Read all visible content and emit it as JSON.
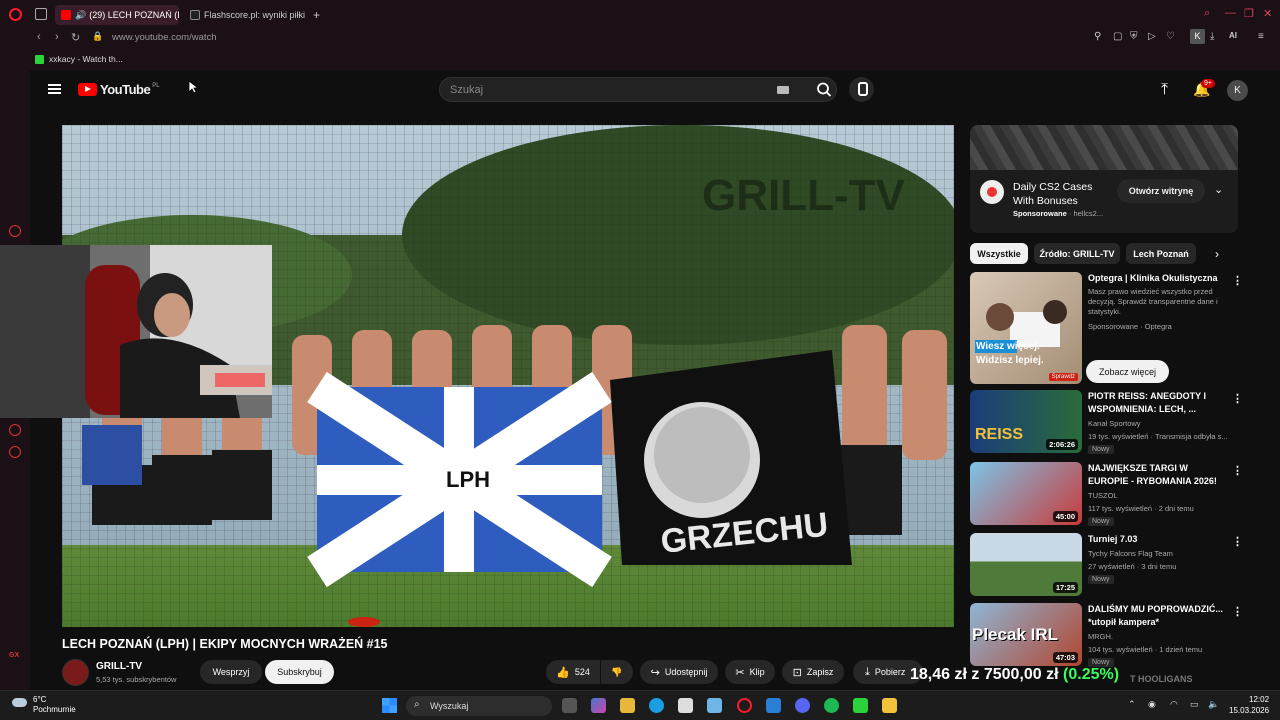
{
  "browser": {
    "tabs": [
      {
        "label": "(29) LECH POZNAŃ (L",
        "active": true
      },
      {
        "label": "Flashscore.pl: wyniki piłki",
        "active": false
      }
    ],
    "new_tab": "+",
    "url": "www.youtube.com/watch",
    "bookmark": "xxkacy - Watch th...",
    "profile_initial": "K",
    "ai_label": "AI",
    "sidebar_gx": "GX"
  },
  "youtube": {
    "logo_text": "YouTube",
    "region": "PL",
    "search_placeholder": "Szukaj",
    "notifications": "9+",
    "account_initial": "K",
    "video": {
      "title": "LECH POZNAŃ (LPH) | EKIPY MOCNYCH WRAŻEŃ #15",
      "overlay_watermark": "GRILL-TV",
      "banner_text": "LPH",
      "banner2_text": "GRZECHU"
    },
    "channel": {
      "name": "GRILL-TV",
      "subs": "5,53 tys. subskrybentów"
    },
    "actions": {
      "support": "Wesprzyj",
      "subscribe": "Subskrybuj",
      "likes": "524",
      "share": "Udostępnij",
      "clip": "Klip",
      "save": "Zapisz",
      "download": "Pobierz"
    },
    "ad": {
      "title": "Daily CS2 Cases With Bonuses",
      "sponsored": "Sponsorowane",
      "domain": "hellcs2...",
      "button": "Otwórz witrynę"
    },
    "chips": [
      "Wszystkie",
      "Źródło: GRILL-TV",
      "Lech Poznań"
    ],
    "recommendations": [
      {
        "title": "Optegra | Klinika Okulistyczna",
        "channel": "Masz prawo wiedzieć wszystko przed decyzją. Sprawdź transparentne dane i statystyki.",
        "meta": "Sponsorowane · Optegra",
        "thumb_text_1": "Wiesz więcej.",
        "thumb_text_2": "Widzisz lepiej.",
        "cta": "Zobacz więcej",
        "sponsored_tag": "Sprawdź"
      },
      {
        "title": "PIOTR REISS:  ANEGDOTY I WSPOMNIENIA: LECH, ...",
        "channel": "Kanał Sportowy",
        "meta": "19 tys. wyświetleń · Transmisja odbyła s...",
        "badge": "Nowy",
        "duration": "2:06:26",
        "thumb_text": "REISS"
      },
      {
        "title": "NAJWIĘKSZE TARGI W EUROPIE - RYBOMANIA 2026!",
        "channel": "TUSZOL",
        "meta": "117 tys. wyświetleń · 2 dni temu",
        "badge": "Nowy",
        "duration": "45:00"
      },
      {
        "title": "Turniej 7.03",
        "channel": "Tychy Falcons Flag Team",
        "meta": "27 wyświetleń · 3 dni temu",
        "badge": "Nowy",
        "duration": "17:25"
      },
      {
        "title": "DALIŚMY MU POPROWADZIĆ... *utopił kampera*",
        "channel": "MRGH.",
        "meta": "104 tys. wyświetleń · 1 dzień temu",
        "badge": "Nowy",
        "duration": "47:03",
        "thumb_text": "Plecak IRL"
      }
    ]
  },
  "stream_overlay": {
    "donation": "18,46 zł",
    "goal": "z 7500,00 zł",
    "percent": "(0.25%)",
    "ticker": "T HOOLIGANS"
  },
  "taskbar": {
    "temp": "6°C",
    "weather": "Pochmurnie",
    "search": "Wyszukaj",
    "time": "12:02",
    "date": "15.03.2026"
  },
  "colors": {
    "accent": "#ff0000",
    "opera": "#ff1b2d",
    "goal_green": "#38ff5a"
  }
}
